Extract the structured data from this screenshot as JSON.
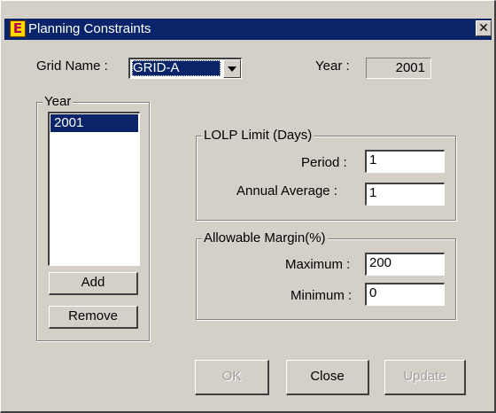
{
  "window": {
    "title": "Planning Constraints",
    "app_icon": "app-e-icon",
    "close_label": "✕"
  },
  "grid": {
    "label": "Grid Name :",
    "selected": "GRID-A"
  },
  "year_display": {
    "label": "Year :",
    "value": "2001"
  },
  "year_group": {
    "title": "Year",
    "items": [
      "2001"
    ],
    "selected_index": 0,
    "add_label": "Add",
    "remove_label": "Remove"
  },
  "lolp_group": {
    "title": "LOLP Limit (Days)",
    "period_label": "Period :",
    "period_value": "1",
    "annual_label": "Annual Average :",
    "annual_value": "1"
  },
  "margin_group": {
    "title": "Allowable Margin(%)",
    "max_label": "Maximum :",
    "max_value": "200",
    "min_label": "Minimum :",
    "min_value": "0"
  },
  "buttons": {
    "ok_label": "OK",
    "ok_enabled": false,
    "close_label": "Close",
    "close_enabled": true,
    "update_label": "Update",
    "update_enabled": false
  },
  "colors": {
    "titlebar": "#0a246a",
    "face": "#d4d0c8",
    "selection": "#0a246a"
  }
}
